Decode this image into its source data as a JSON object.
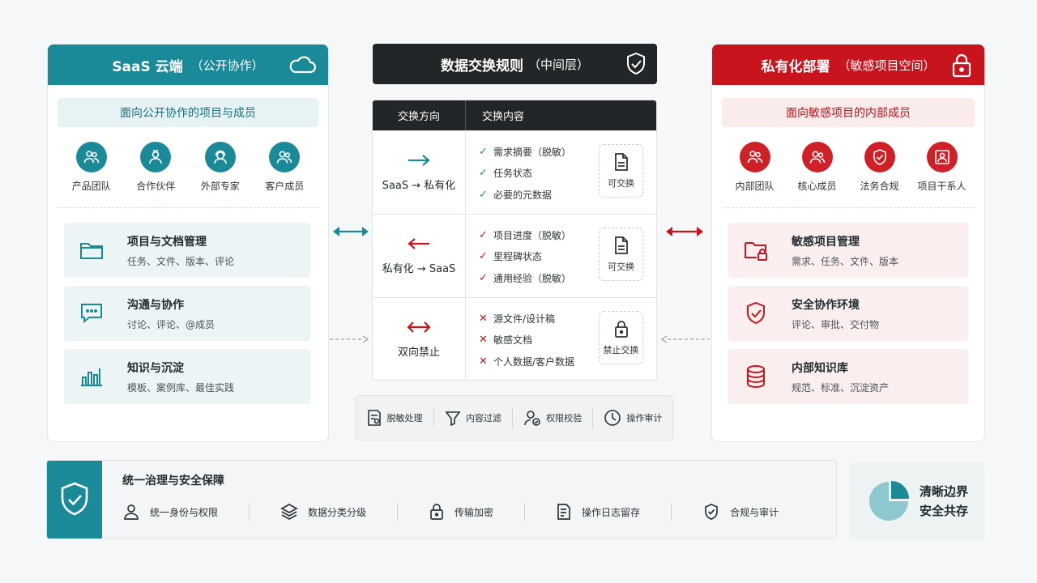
{
  "left_panel": {
    "title": "SaaS 云端",
    "subtitle": "（公开协作）",
    "audience": "面向公开协作的项目与成员",
    "roles": [
      {
        "label": "产品团队",
        "icon": "users-icon"
      },
      {
        "label": "合作伙伴",
        "icon": "partner-icon"
      },
      {
        "label": "外部专家",
        "icon": "expert-icon"
      },
      {
        "label": "客户成员",
        "icon": "customer-icon"
      }
    ],
    "features": [
      {
        "title": "项目与文档管理",
        "desc": "任务、文件、版本、评论",
        "icon": "folder-icon"
      },
      {
        "title": "沟通与协作",
        "desc": "讨论、评论、@成员",
        "icon": "chat-icon"
      },
      {
        "title": "知识与沉淀",
        "desc": "模板、案例库、最佳实践",
        "icon": "chart-icon"
      }
    ]
  },
  "middle": {
    "title": "数据交换规则",
    "subtitle": "（中间层）",
    "table_headers": {
      "direction": "交换方向",
      "content": "交换内容"
    },
    "rows": [
      {
        "direction": "SaaS → 私有化",
        "items": [
          "需求摘要（脱敏）",
          "任务状态",
          "必要的元数据"
        ],
        "badge": "可交换"
      },
      {
        "direction": "私有化 → SaaS",
        "items": [
          "项目进度（脱敏）",
          "里程碑状态",
          "通用经验（脱敏）"
        ],
        "badge": "可交换"
      },
      {
        "direction": "双向禁止",
        "items": [
          "源文件/设计稿",
          "敏感文档",
          "个人数据/客户数据"
        ],
        "badge": "禁止交换"
      }
    ],
    "tools": [
      "脱敏处理",
      "内容过滤",
      "权限校验",
      "操作审计"
    ]
  },
  "right_panel": {
    "title": "私有化部署",
    "subtitle": "（敏感项目空间）",
    "audience": "面向敏感项目的内部成员",
    "roles": [
      {
        "label": "内部团队",
        "icon": "users-icon"
      },
      {
        "label": "核心成员",
        "icon": "core-member-icon"
      },
      {
        "label": "法务合规",
        "icon": "shield-icon"
      },
      {
        "label": "项目干系人",
        "icon": "stakeholder-icon"
      }
    ],
    "features": [
      {
        "title": "敏感项目管理",
        "desc": "需求、任务、文件、版本",
        "icon": "locked-folder-icon"
      },
      {
        "title": "安全协作环境",
        "desc": "评论、审批、交付物",
        "icon": "shield-check-icon"
      },
      {
        "title": "内部知识库",
        "desc": "规范、标准、沉淀资产",
        "icon": "database-icon"
      }
    ]
  },
  "governance": {
    "title": "统一治理与安全保障",
    "items": [
      "统一身份与权限",
      "数据分类分级",
      "传输加密",
      "操作日志留存",
      "合规与审计"
    ]
  },
  "summary": {
    "line1": "清晰边界",
    "line2": "安全共存"
  },
  "colors": {
    "teal": "#1a8a99",
    "red": "#c8141c",
    "dark": "#232628"
  }
}
